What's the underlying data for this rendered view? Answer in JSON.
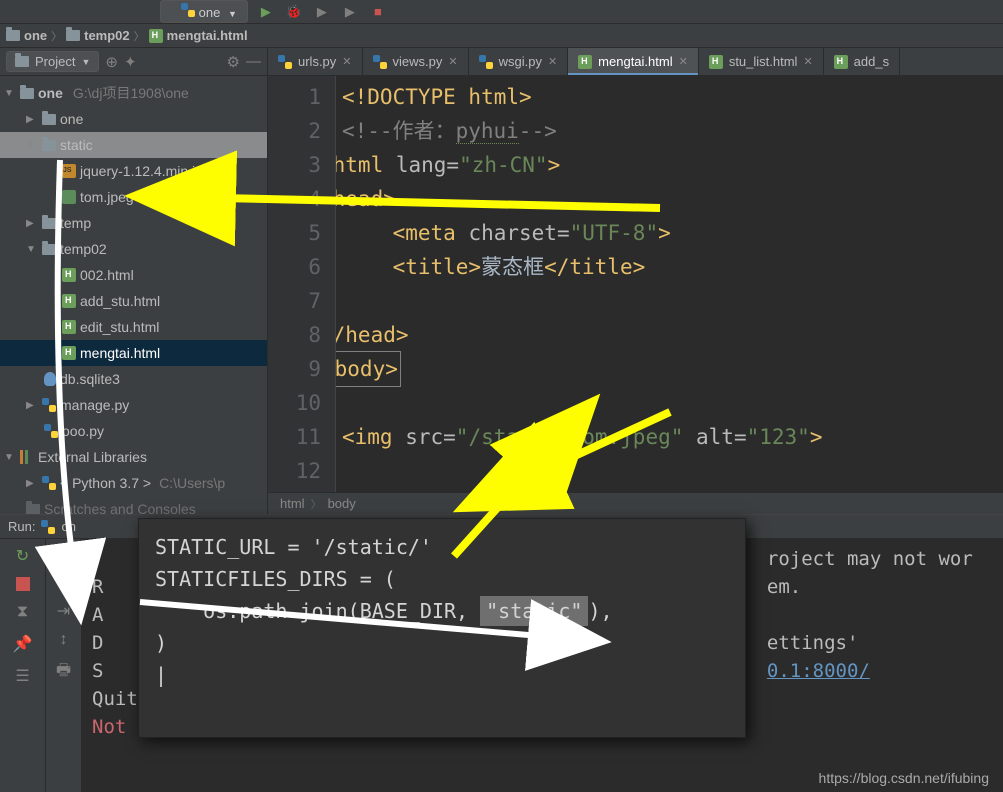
{
  "top": {
    "run_config": "one"
  },
  "breadcrumb": {
    "items": [
      "one",
      "temp02",
      "mengtai.html"
    ]
  },
  "sidebar": {
    "header_button": "Project",
    "tree": {
      "root": "one",
      "root_path": "G:\\dj项目1908\\one",
      "folder_one": "one",
      "folder_static": "static",
      "file_jquery": "jquery-1.12.4.min.js",
      "file_tom": "tom.jpeg",
      "folder_temp": "temp",
      "folder_temp02": "temp02",
      "file_002": "002.html",
      "file_addstu": "add_stu.html",
      "file_editstu": "edit_stu.html",
      "file_mengtai": "mengtai.html",
      "file_db": "db.sqlite3",
      "file_manage": "manage.py",
      "file_ooo": "ooo.py",
      "ext_lib": "External Libraries",
      "python": "< Python 3.7 >",
      "python_path": "C:\\Users\\p",
      "scratch": "Scratches and Consoles"
    }
  },
  "tabs": {
    "t1": "urls.py",
    "t2": "views.py",
    "t3": "wsgi.py",
    "t4": "mengtai.html",
    "t5": "stu_list.html",
    "t6": "add_s"
  },
  "code": {
    "line_numbers": [
      "1",
      "2",
      "3",
      "4",
      "5",
      "6",
      "7",
      "8",
      "9",
      "10",
      "11",
      "12"
    ],
    "l1": "<!DOCTYPE html>",
    "l2_open": "<!--",
    "l2_text": "作者：",
    "l2_name": "pyhui",
    "l2_close": "-->",
    "l3_tag_open": "<html ",
    "l3_attr": "lang=",
    "l3_val": "\"zh-CN\"",
    "l3_close": ">",
    "l4": "<head>",
    "l5_tag": "<meta ",
    "l5_attr": "charset=",
    "l5_val": "\"UTF-8\"",
    "l5_close": ">",
    "l6_open": "<title>",
    "l6_text": "蒙态框",
    "l6_close": "</title>",
    "l8": "</head>",
    "l9": "<body>",
    "l11_tag": "<img ",
    "l11_attr1": "src=",
    "l11_val1": "\"/static/tom.jpeg\"",
    "l11_attr2": " alt=",
    "l11_val2": "\"123\"",
    "l11_close": ">"
  },
  "code_crumb": {
    "a": "html",
    "b": "body"
  },
  "run": {
    "label": "Run:",
    "target": "on",
    "console_partial_top": "roject may not wor",
    "line2_right": "em.",
    "line4_right": "ettings'",
    "link": "0.1:8000/",
    "quit": "Quit the server with CTRL-BREAK.",
    "notfound": "Not Found: /",
    "prefix_letters": [
      "R",
      "A",
      "D",
      "S"
    ]
  },
  "popup": {
    "l1_key": "STATIC_URL",
    "l1_val": "'/static/'",
    "l2_key": "STATICFILES_DIRS",
    "l3_pre": "os.path.join(BASE_DIR, ",
    "l3_val": "\"static\"",
    "l3_post": "),"
  },
  "watermark": "https://blog.csdn.net/ifubing"
}
